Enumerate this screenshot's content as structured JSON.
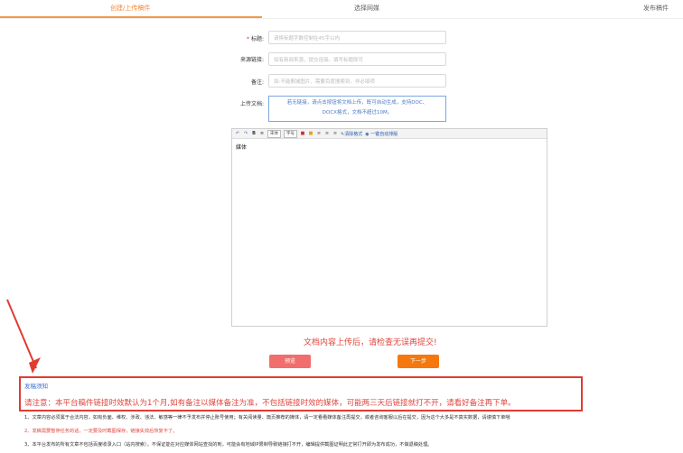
{
  "tabs": [
    {
      "label": "创建/上传稿件",
      "active": true
    },
    {
      "label": "选择网媒",
      "active": false
    },
    {
      "label": "发布稿件",
      "active": false
    }
  ],
  "form": {
    "title_label": "标题:",
    "title_required_mark": "*",
    "title_placeholder": "请将标题字数控制在45字以内",
    "source_label": "来源链接:",
    "source_placeholder": "如有新闻来源，提交连接。填写标题即可",
    "remark_label": "备注:",
    "remark_placeholder": "如:不能删减图片、需要百度搜索到、非必填项",
    "upload_label": "上传文档:",
    "upload_line1": "若无链接，请点击按钮将文档上传，既可自动生成，支持DOC、",
    "upload_line2": "DOCX格式，文档不超过10M。"
  },
  "editor": {
    "toolbar": {
      "font_select": "宋体",
      "size_select": "字号",
      "clear_format": "清除格式",
      "auto_format": "一键自动排版"
    },
    "content": "媒体"
  },
  "warning": "文档内容上传后，请检查无误再提交!",
  "buttons": {
    "preview": "预览",
    "next": "下一步"
  },
  "notice": {
    "title": "发稿须知",
    "main": "请注意：本平台稿件链接时效默认为1个月,如有备注以媒体备注为准，不包括链接时效的媒体，可能两三天后链接就打不开，请看好备注再下单。",
    "rules": [
      {
        "text": "1、文章内容必须属于合法内容，如有负面、维权、涉政、违法、敏感等一律不予发布并停止账号使用；有关阅读量、篇页推荐的媒体，请一定看看媒体备注再提交，或者咨询客服以后在提交，因为这个大多是不真实数据，请谨慎下单哦",
        "red": false
      },
      {
        "text": "2、发稿需要暂停任务的话，一定要及时截图保存，链接失效后恢复不了。",
        "red": true
      },
      {
        "text": "3、本平台发布的所有文章不包括百度收录入口（站内搜索），不保证能在对应媒体网站查找的到，可能会有地域IP限制导致链接打不开，编辑提供截图证明此正常打开即为发布成功，不做退稿处理。",
        "red": false
      }
    ]
  },
  "colors": {
    "accent_orange": "#f5780f",
    "warning_red": "#e0443b",
    "preview_pink": "#f26d6d",
    "link_blue": "#3b6fd1"
  }
}
